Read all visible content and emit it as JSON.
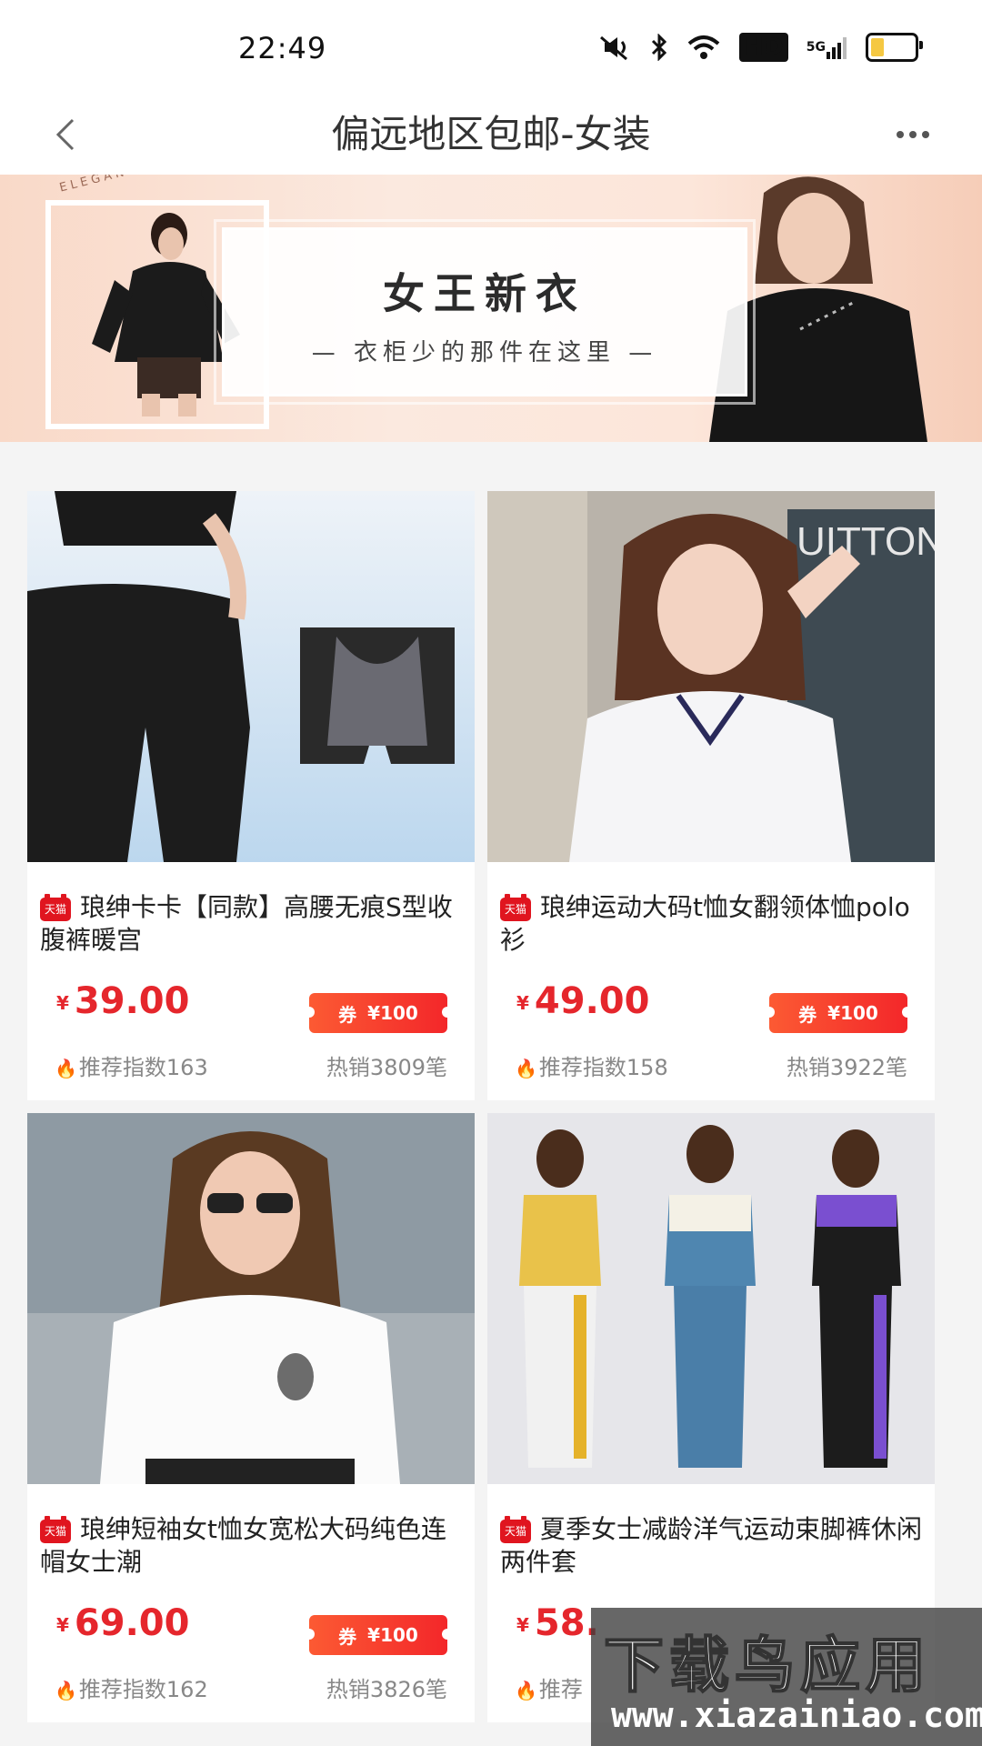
{
  "status_bar": {
    "time": "22:49",
    "icons": [
      "mute-icon",
      "bluetooth-icon",
      "wifi-icon",
      "hd-icon",
      "signal-5g-icon",
      "battery-icon"
    ],
    "hd_label": "HD",
    "network_label": "5G",
    "battery_level": 0.3,
    "battery_color": "#f5c842"
  },
  "nav": {
    "title": "偏远地区包邮-女装"
  },
  "banner": {
    "motto": "ELEGANT EVERY MOMENT",
    "title": "女王新衣",
    "subtitle": "— 衣柜少的那件在这里 —"
  },
  "products": [
    {
      "badge": "天猫",
      "title": "琅绅卡卡【同款】高腰无痕S型收腹裤暖宫",
      "currency": "¥",
      "price": "39.00",
      "coupon_label": "券",
      "coupon_value": "¥100",
      "score": "推荐指数163",
      "sales": "热销3809笔"
    },
    {
      "badge": "天猫",
      "title": "琅绅运动大码t恤女翻领体恤polo衫",
      "currency": "¥",
      "price": "49.00",
      "coupon_label": "券",
      "coupon_value": "¥100",
      "score": "推荐指数158",
      "sales": "热销3922笔"
    },
    {
      "badge": "天猫",
      "title": "琅绅短袖女t恤女宽松大码纯色连帽女士潮",
      "currency": "¥",
      "price": "69.00",
      "coupon_label": "券",
      "coupon_value": "¥100",
      "score": "推荐指数162",
      "sales": "热销3826笔"
    },
    {
      "badge": "天猫",
      "title": "夏季女士减龄洋气运动束脚裤休闲两件套",
      "currency": "¥",
      "price": "58.",
      "coupon_label": "券",
      "coupon_value": "¥100",
      "score": "推荐",
      "sales": ""
    }
  ],
  "watermark": {
    "cn": "下载鸟应用",
    "url": "www.xiazainiao.com"
  },
  "colors": {
    "accent": "#e5262c",
    "tmall_red": "#e0151f",
    "coupon_gradient": [
      "#fc5a33",
      "#f3272a"
    ]
  }
}
